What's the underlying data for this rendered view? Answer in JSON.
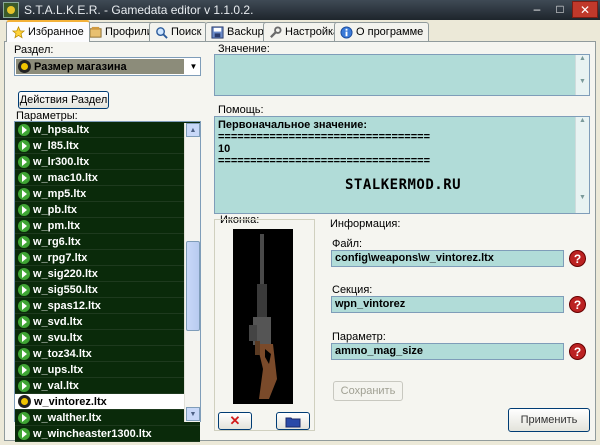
{
  "window": {
    "title": "S.T.A.L.K.E.R. - Gamedata editor v 1.1.0.2.",
    "minimize": "–",
    "maximize": "□",
    "close": "✕"
  },
  "tabs": [
    {
      "label": "Избранное",
      "icon": "star-icon",
      "active": true
    },
    {
      "label": "Профили",
      "icon": "profile-icon",
      "active": false
    },
    {
      "label": "Поиск",
      "icon": "search-icon",
      "active": false
    },
    {
      "label": "Backup",
      "icon": "backup-icon",
      "active": false
    },
    {
      "label": "Настройка",
      "icon": "settings-icon",
      "active": false
    },
    {
      "label": "О программе",
      "icon": "info-icon",
      "active": false
    }
  ],
  "section": {
    "label": "Раздел:",
    "selected": "Размер магазина",
    "actions_button": "Действия Раздел"
  },
  "params": {
    "label": "Параметры:",
    "items": [
      "w_hpsa.ltx",
      "w_l85.ltx",
      "w_lr300.ltx",
      "w_mac10.ltx",
      "w_mp5.ltx",
      "w_pb.ltx",
      "w_pm.ltx",
      "w_rg6.ltx",
      "w_rpg7.ltx",
      "w_sig220.ltx",
      "w_sig550.ltx",
      "w_spas12.ltx",
      "w_svd.ltx",
      "w_svu.ltx",
      "w_toz34.ltx",
      "w_ups.ltx",
      "w_val.ltx",
      "w_vintorez.ltx",
      "w_walther.ltx",
      "w_wincheaster1300.ltx"
    ],
    "selected": "w_vintorez.ltx"
  },
  "value": {
    "label": "Значение:",
    "text": ""
  },
  "help": {
    "label": "Помощь:",
    "lines": [
      "Первоначальное значение:",
      "=================================",
      "10",
      "================================="
    ],
    "watermark": "STALKERMOD.RU"
  },
  "icon_group": {
    "label": "Иконка:",
    "delete_glyph": "✕"
  },
  "info": {
    "label": "Информация:",
    "file_label": "Файл:",
    "file_value": "config\\weapons\\w_vintorez.ltx",
    "section_label": "Секция:",
    "section_value": "wpn_vintorez",
    "param_label": "Параметр:",
    "param_value": "ammo_mag_size",
    "help_glyph": "?",
    "save_button": "Сохранить"
  },
  "apply_button": "Применить",
  "colors": {
    "field_bg": "#b1dcd8",
    "list_bg": "#0a2a0a",
    "accent": "#f4b23a"
  }
}
